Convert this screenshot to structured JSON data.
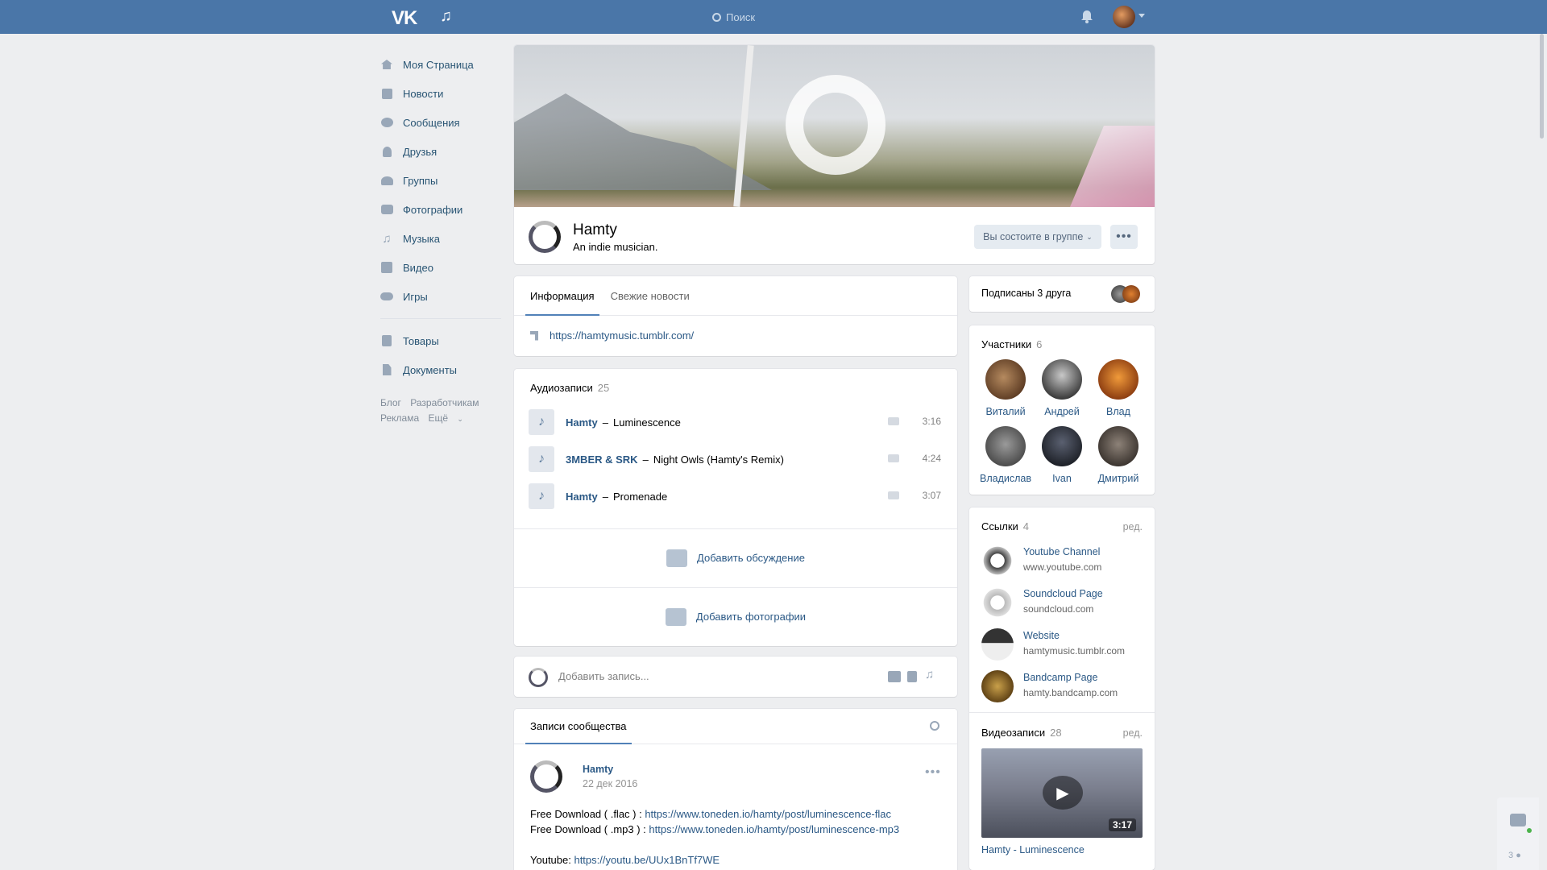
{
  "header": {
    "logo": "VK",
    "search_placeholder": "Поиск"
  },
  "sidebar": {
    "items": [
      {
        "label": "Моя Страница",
        "icon": "home-icon"
      },
      {
        "label": "Новости",
        "icon": "news-icon"
      },
      {
        "label": "Сообщения",
        "icon": "messages-icon"
      },
      {
        "label": "Друзья",
        "icon": "friends-icon"
      },
      {
        "label": "Группы",
        "icon": "groups-icon"
      },
      {
        "label": "Фотографии",
        "icon": "camera-icon"
      },
      {
        "label": "Музыка",
        "icon": "music-icon"
      },
      {
        "label": "Видео",
        "icon": "video-icon"
      },
      {
        "label": "Игры",
        "icon": "gamepad-icon"
      }
    ],
    "items2": [
      {
        "label": "Товары",
        "icon": "bag-icon"
      },
      {
        "label": "Документы",
        "icon": "document-icon"
      }
    ],
    "footer": {
      "blog": "Блог",
      "developers": "Разработчикам",
      "ads": "Реклама",
      "more": "Ещё"
    }
  },
  "group": {
    "name": "Hamty",
    "status": "An indie musician.",
    "member_button": "Вы состоите в группе",
    "more_button": "•••"
  },
  "info": {
    "tabs": [
      "Информация",
      "Свежие новости"
    ],
    "url": "https://hamtymusic.tumblr.com/"
  },
  "audio": {
    "title": "Аудиозаписи",
    "count": "25",
    "tracks": [
      {
        "artist": "Hamty",
        "title": "Luminescence",
        "duration": "3:16"
      },
      {
        "artist": "3MBER & SRK",
        "title": "Night Owls (Hamty's Remix)",
        "duration": "4:24"
      },
      {
        "artist": "Hamty",
        "title": "Promenade",
        "duration": "3:07"
      }
    ],
    "dash": "–",
    "add_discussion": "Добавить обсуждение",
    "add_photos": "Добавить фотографии"
  },
  "composer": {
    "placeholder": "Добавить запись..."
  },
  "posts": {
    "tab": "Записи сообщества",
    "post": {
      "author": "Hamty",
      "date": "22 дек 2016",
      "line1_prefix": "Free Download ( .flac ) : ",
      "line1_link": "https://www.toneden.io/hamty/post/luminescence-flac",
      "line2_prefix": "Free Download ( .mp3 ) : ",
      "line2_link": "https://www.toneden.io/hamty/post/luminescence-mp3",
      "line3_prefix": "Youtube: ",
      "line3_link": "https://youtu.be/UUx1BnTf7WE"
    }
  },
  "friends": {
    "text": "Подписаны 3 друга"
  },
  "members": {
    "title": "Участники",
    "count": "6",
    "list": [
      "Виталий",
      "Андрей",
      "Влад",
      "Владислав",
      "Ivan",
      "Дмитрий"
    ]
  },
  "links": {
    "title": "Ссылки",
    "count": "4",
    "edit": "ред.",
    "list": [
      {
        "title": "Youtube Channel",
        "sub": "www.youtube.com"
      },
      {
        "title": "Soundcloud Page",
        "sub": "soundcloud.com"
      },
      {
        "title": "Website",
        "sub": "hamtymusic.tumblr.com"
      },
      {
        "title": "Bandcamp Page",
        "sub": "hamty.bandcamp.com"
      }
    ]
  },
  "videos": {
    "title": "Видеозаписи",
    "count": "28",
    "edit": "ред.",
    "video_title": "Hamty - Luminescence",
    "duration": "3:17"
  },
  "widget": {
    "count": "3"
  },
  "colors": {
    "header": "#4a76a8",
    "link": "#2a5885",
    "background": "#edeef0"
  }
}
